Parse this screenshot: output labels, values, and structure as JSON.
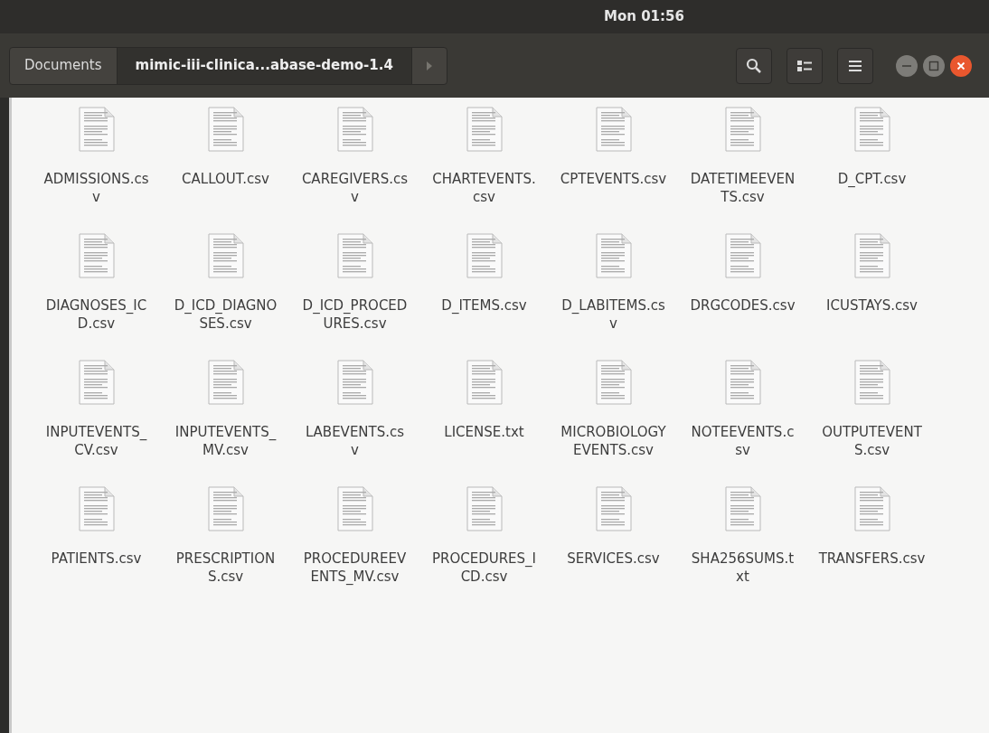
{
  "top_bar": {
    "clock": "Mon 01:56"
  },
  "path_bar": [
    {
      "label": "Documents",
      "selected": false
    },
    {
      "label": "mimic-iii-clinica...abase-demo-1.4",
      "selected": true
    }
  ],
  "files": [
    {
      "name": "ADMISSIONS.csv"
    },
    {
      "name": "CALLOUT.csv"
    },
    {
      "name": "CAREGIVERS.csv"
    },
    {
      "name": "CHARTEVENTS.csv"
    },
    {
      "name": "CPTEVENTS.csv"
    },
    {
      "name": "DATETIMEEVENTS.csv"
    },
    {
      "name": "D_CPT.csv"
    },
    {
      "name": "DIAGNOSES_ICD.csv"
    },
    {
      "name": "D_ICD_DIAGNOSES.csv"
    },
    {
      "name": "D_ICD_PROCEDURES.csv"
    },
    {
      "name": "D_ITEMS.csv"
    },
    {
      "name": "D_LABITEMS.csv"
    },
    {
      "name": "DRGCODES.csv"
    },
    {
      "name": "ICUSTAYS.csv"
    },
    {
      "name": "INPUTEVENTS_CV.csv"
    },
    {
      "name": "INPUTEVENTS_MV.csv"
    },
    {
      "name": "LABEVENTS.csv"
    },
    {
      "name": "LICENSE.txt"
    },
    {
      "name": "MICROBIOLOGYEVENTS.csv"
    },
    {
      "name": "NOTEEVENTS.csv"
    },
    {
      "name": "OUTPUTEVENTS.csv"
    },
    {
      "name": "PATIENTS.csv"
    },
    {
      "name": "PRESCRIPTIONS.csv"
    },
    {
      "name": "PROCEDUREEVENTS_MV.csv"
    },
    {
      "name": "PROCEDURES_ICD.csv"
    },
    {
      "name": "SERVICES.csv"
    },
    {
      "name": "SHA256SUMS.txt"
    },
    {
      "name": "TRANSFERS.csv"
    }
  ]
}
